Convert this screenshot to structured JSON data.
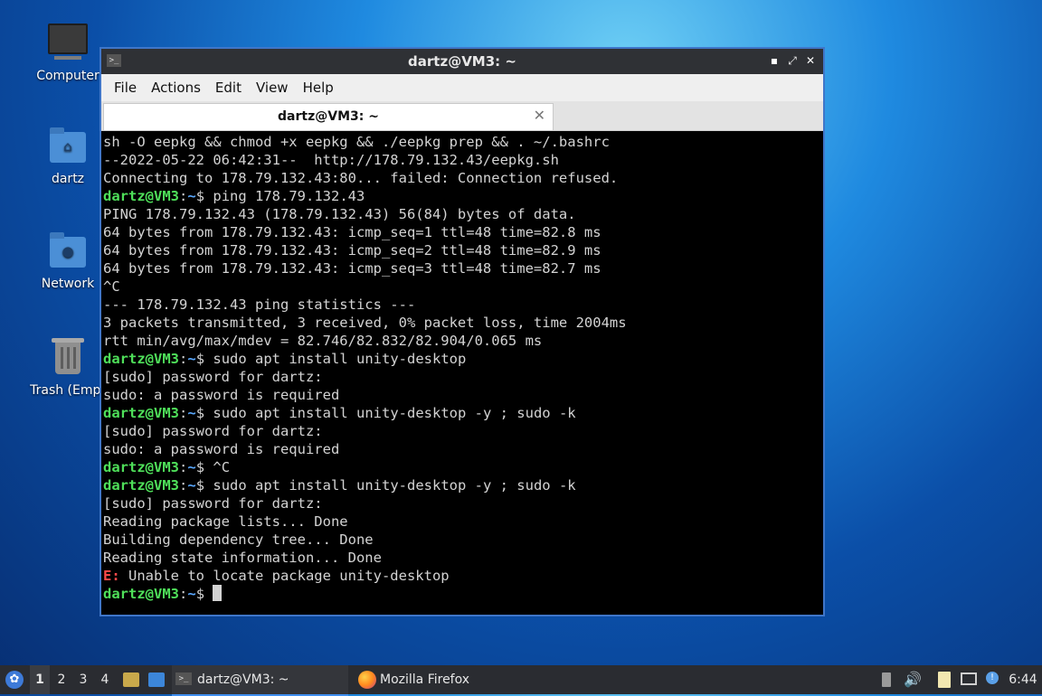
{
  "desktop": {
    "icons": [
      {
        "label": "Computer"
      },
      {
        "label": "dartz"
      },
      {
        "label": "Network"
      },
      {
        "label": "Trash (Empt"
      }
    ]
  },
  "window": {
    "title": "dartz@VM3: ~",
    "buttons": {
      "minimize": "▪",
      "maximize": "⤢",
      "close": "✕"
    },
    "menu": [
      "File",
      "Actions",
      "Edit",
      "View",
      "Help"
    ],
    "tab": {
      "label": "dartz@VM3: ~",
      "close": "✕"
    },
    "terminal": {
      "prompt_user": "dartz@VM3",
      "prompt_sep": ":",
      "prompt_path": "~",
      "prompt_dollar": "$ ",
      "lines": [
        {
          "type": "out",
          "text": "sh -O eepkg && chmod +x eepkg && ./eepkg prep && . ~/.bashrc"
        },
        {
          "type": "out",
          "text": "--2022-05-22 06:42:31--  http://178.79.132.43/eepkg.sh"
        },
        {
          "type": "out",
          "text": "Connecting to 178.79.132.43:80... failed: Connection refused."
        },
        {
          "type": "prompt",
          "text": "ping 178.79.132.43"
        },
        {
          "type": "out",
          "text": "PING 178.79.132.43 (178.79.132.43) 56(84) bytes of data."
        },
        {
          "type": "out",
          "text": "64 bytes from 178.79.132.43: icmp_seq=1 ttl=48 time=82.8 ms"
        },
        {
          "type": "out",
          "text": "64 bytes from 178.79.132.43: icmp_seq=2 ttl=48 time=82.9 ms"
        },
        {
          "type": "out",
          "text": "64 bytes from 178.79.132.43: icmp_seq=3 ttl=48 time=82.7 ms"
        },
        {
          "type": "out",
          "text": "^C"
        },
        {
          "type": "out",
          "text": "--- 178.79.132.43 ping statistics ---"
        },
        {
          "type": "out",
          "text": "3 packets transmitted, 3 received, 0% packet loss, time 2004ms"
        },
        {
          "type": "out",
          "text": "rtt min/avg/max/mdev = 82.746/82.832/82.904/0.065 ms"
        },
        {
          "type": "prompt",
          "text": "sudo apt install unity-desktop"
        },
        {
          "type": "out",
          "text": "[sudo] password for dartz:"
        },
        {
          "type": "out",
          "text": "sudo: a password is required"
        },
        {
          "type": "prompt",
          "text": "sudo apt install unity-desktop -y ; sudo -k"
        },
        {
          "type": "out",
          "text": "[sudo] password for dartz:"
        },
        {
          "type": "out",
          "text": "sudo: a password is required"
        },
        {
          "type": "prompt",
          "text": "^C"
        },
        {
          "type": "prompt",
          "text": "sudo apt install unity-desktop -y ; sudo -k"
        },
        {
          "type": "out",
          "text": "[sudo] password for dartz:"
        },
        {
          "type": "out",
          "text": "Reading package lists... Done"
        },
        {
          "type": "out",
          "text": "Building dependency tree... Done"
        },
        {
          "type": "out",
          "text": "Reading state information... Done"
        },
        {
          "type": "error",
          "tag": "E:",
          "text": " Unable to locate package unity-desktop"
        },
        {
          "type": "cursor",
          "text": ""
        }
      ]
    }
  },
  "taskbar": {
    "workspaces": [
      "1",
      "2",
      "3",
      "4"
    ],
    "active_workspace": "1",
    "tasks": [
      {
        "label": "dartz@VM3: ~",
        "icon": "terminal-icon"
      },
      {
        "label": "Mozilla Firefox",
        "icon": "firefox-icon"
      }
    ],
    "clock": "6:44"
  }
}
